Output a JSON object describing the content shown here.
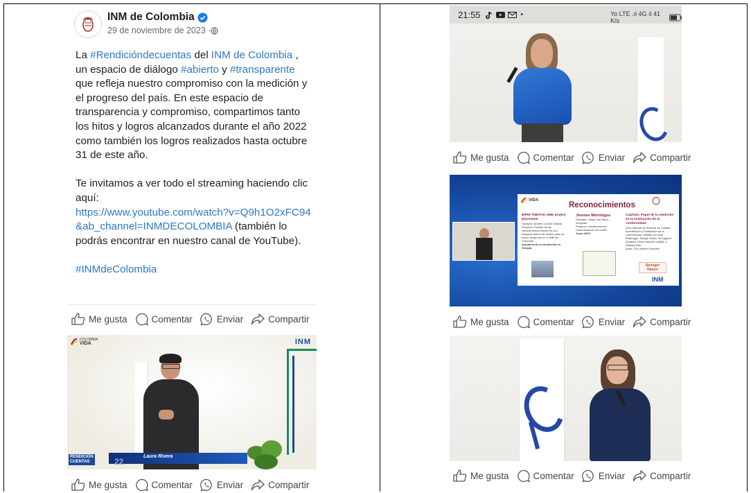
{
  "post": {
    "page_name": "INM de Colombia",
    "date": "29 de noviembre de 2023 · ",
    "body_1": [
      {
        "t": "La ",
        "link": false
      },
      {
        "t": "#Rendicióndecuentas",
        "link": true
      },
      {
        "t": " del ",
        "link": false
      },
      {
        "t": "INM de Colombia",
        "link": true
      },
      {
        "t": " , un espacio de diálogo ",
        "link": false
      },
      {
        "t": "#abierto",
        "link": true
      },
      {
        "t": " y ",
        "link": false
      },
      {
        "t": "#transparente",
        "link": true
      },
      {
        "t": " que refleja nuestro compromiso con la medición y el progreso del país. En este espacio de transparencia y compromiso, compartimos tanto los hitos y logros alcanzados durante el año 2022 como también los logros realizados hasta octubre 31 de este año.",
        "link": false
      }
    ],
    "body_2_prefix": "Te invitamos a ver todo el streaming haciendo clic aquí:",
    "youtube_link": "https://www.youtube.com/watch?v=Q9h1O2xFC94&ab_channel=INMDECOLOMBIA",
    "body_2_suffix": " (también lo podrás encontrar en nuestro canal de YouTube).",
    "hashtag": "#INMdeColombia"
  },
  "actions": {
    "like": "Me gusta",
    "comment": "Comentar",
    "send": "Enviar",
    "share": "Compartir"
  },
  "status_bar": {
    "time": "21:55",
    "right": "Yo LTE .ıl 4G ıl 41 K/s"
  },
  "video1": {
    "brand_line1": "COLOMBIA",
    "brand_line2": "VIDA",
    "logo": "INM",
    "caption_name": "Laura Rivera",
    "rendicion_1": "RENDICIÓN",
    "rendicion_2": "CUENTAS",
    "year_fragment": "22"
  },
  "slide": {
    "title": "Reconocimientos",
    "brand": "VIDA",
    "col1_title": "BIPM-TÜBITAK UME project placement",
    "col1_lines": [
      "Ganador: Andrés Camilo Salazar",
      "Proyecto: Estudio de las características físicas de una máquina patrón de torsión para un futuro desarrollo en el INM de Colombia",
      "Actualmente en desarrollo en Turquía"
    ],
    "col2_title": "Jóvenes Metrólogos",
    "col2_lines": [
      "Ganador: Jorge Luis Salvo Arroyabe",
      "Proyecto: Interferometría",
      "Universidad de los Andes",
      "Junio 2023"
    ],
    "col3_title": "Capítulo, Papel de la medición en la evaluación de la conformidad.",
    "col3_lines": [
      "Libro Manual de Sistema de Calidad, Acreditación y Evaluación de la Conformidad, editado por Anuj Bhatnagar, Sanjay Yadav, Venugopal Achanta, Ulrich Harmes-Liedtke y Shanay Rab",
      "Autor: Ciro Alberto Sánchez"
    ],
    "springer": "Springer Nature",
    "inm": "INM"
  }
}
